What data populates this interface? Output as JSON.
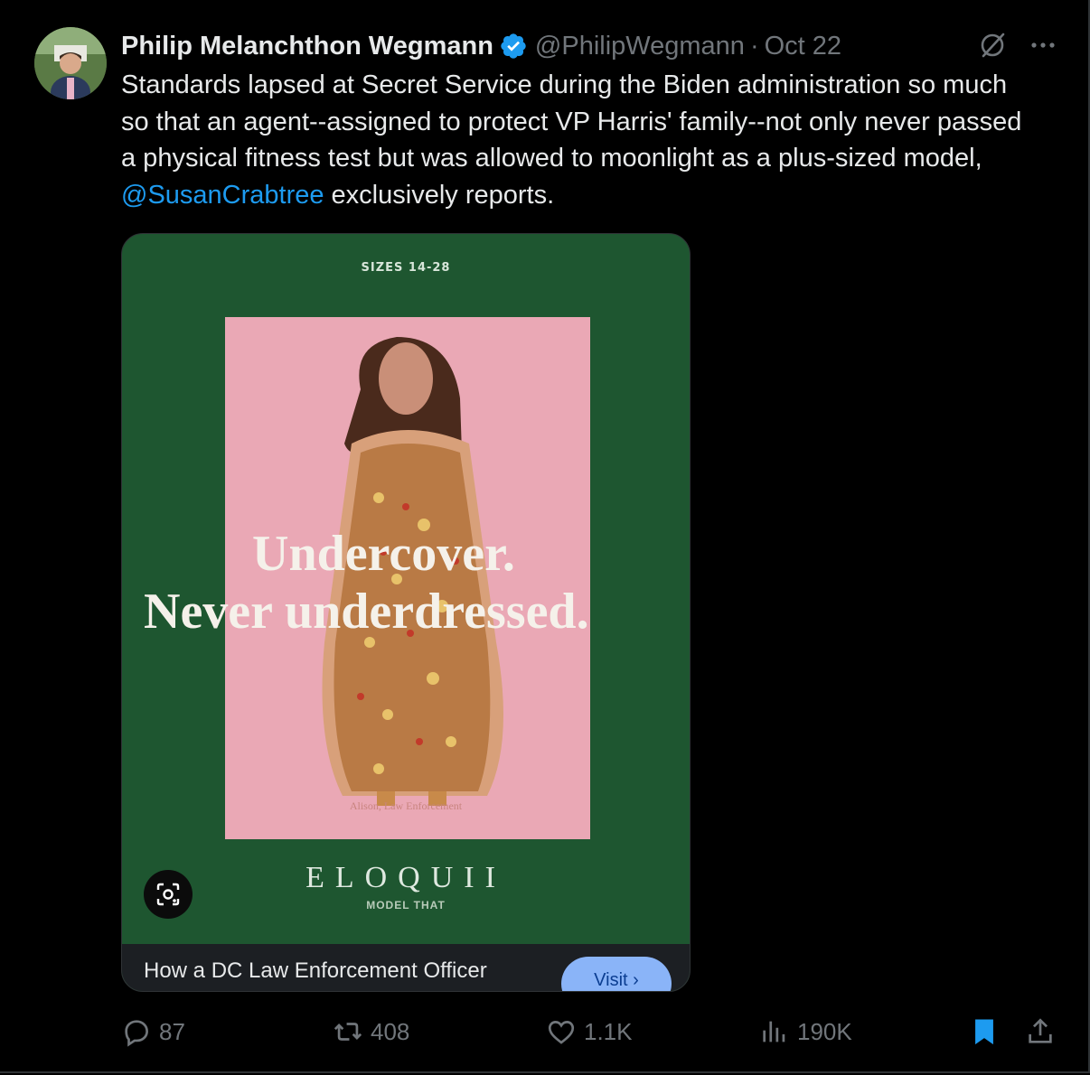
{
  "tweet": {
    "author_name": "Philip Melanchthon Wegmann",
    "handle": "@PhilipWegmann",
    "separator": "·",
    "date": "Oct 22",
    "text_before": "Standards lapsed at Secret Service during the Biden administration so much so that an agent--assigned to protect VP Harris' family--not only never passed a physical fitness test but was allowed to moonlight as a plus-sized model, ",
    "mention": "@SusanCrabtree",
    "text_after": " exclusively reports."
  },
  "card": {
    "ad_sizes": "SIZES 14-28",
    "headline_line1": "Undercover.",
    "headline_line2": "Never underdressed.",
    "ad_caption": "Alison, Law Enforcement",
    "brand": "ELOQUII",
    "brand_tagline": "MODEL THAT",
    "title": "How a DC Law Enforcement Officer",
    "visit_label": "Visit ›"
  },
  "actions": {
    "replies": "87",
    "reposts": "408",
    "likes": "1.1K",
    "views": "190K"
  },
  "icons": {
    "verified": "verified-badge-icon",
    "grok": "grok-icon",
    "more": "more-icon",
    "lens": "image-search-icon",
    "reply": "reply-icon",
    "repost": "repost-icon",
    "like": "like-icon",
    "views": "views-icon",
    "bookmark": "bookmark-icon",
    "share": "share-icon"
  },
  "colors": {
    "accent": "#1d9bf0",
    "muted": "#71767b",
    "card_green": "#1e5630",
    "ad_pink": "#e9a9b4"
  }
}
